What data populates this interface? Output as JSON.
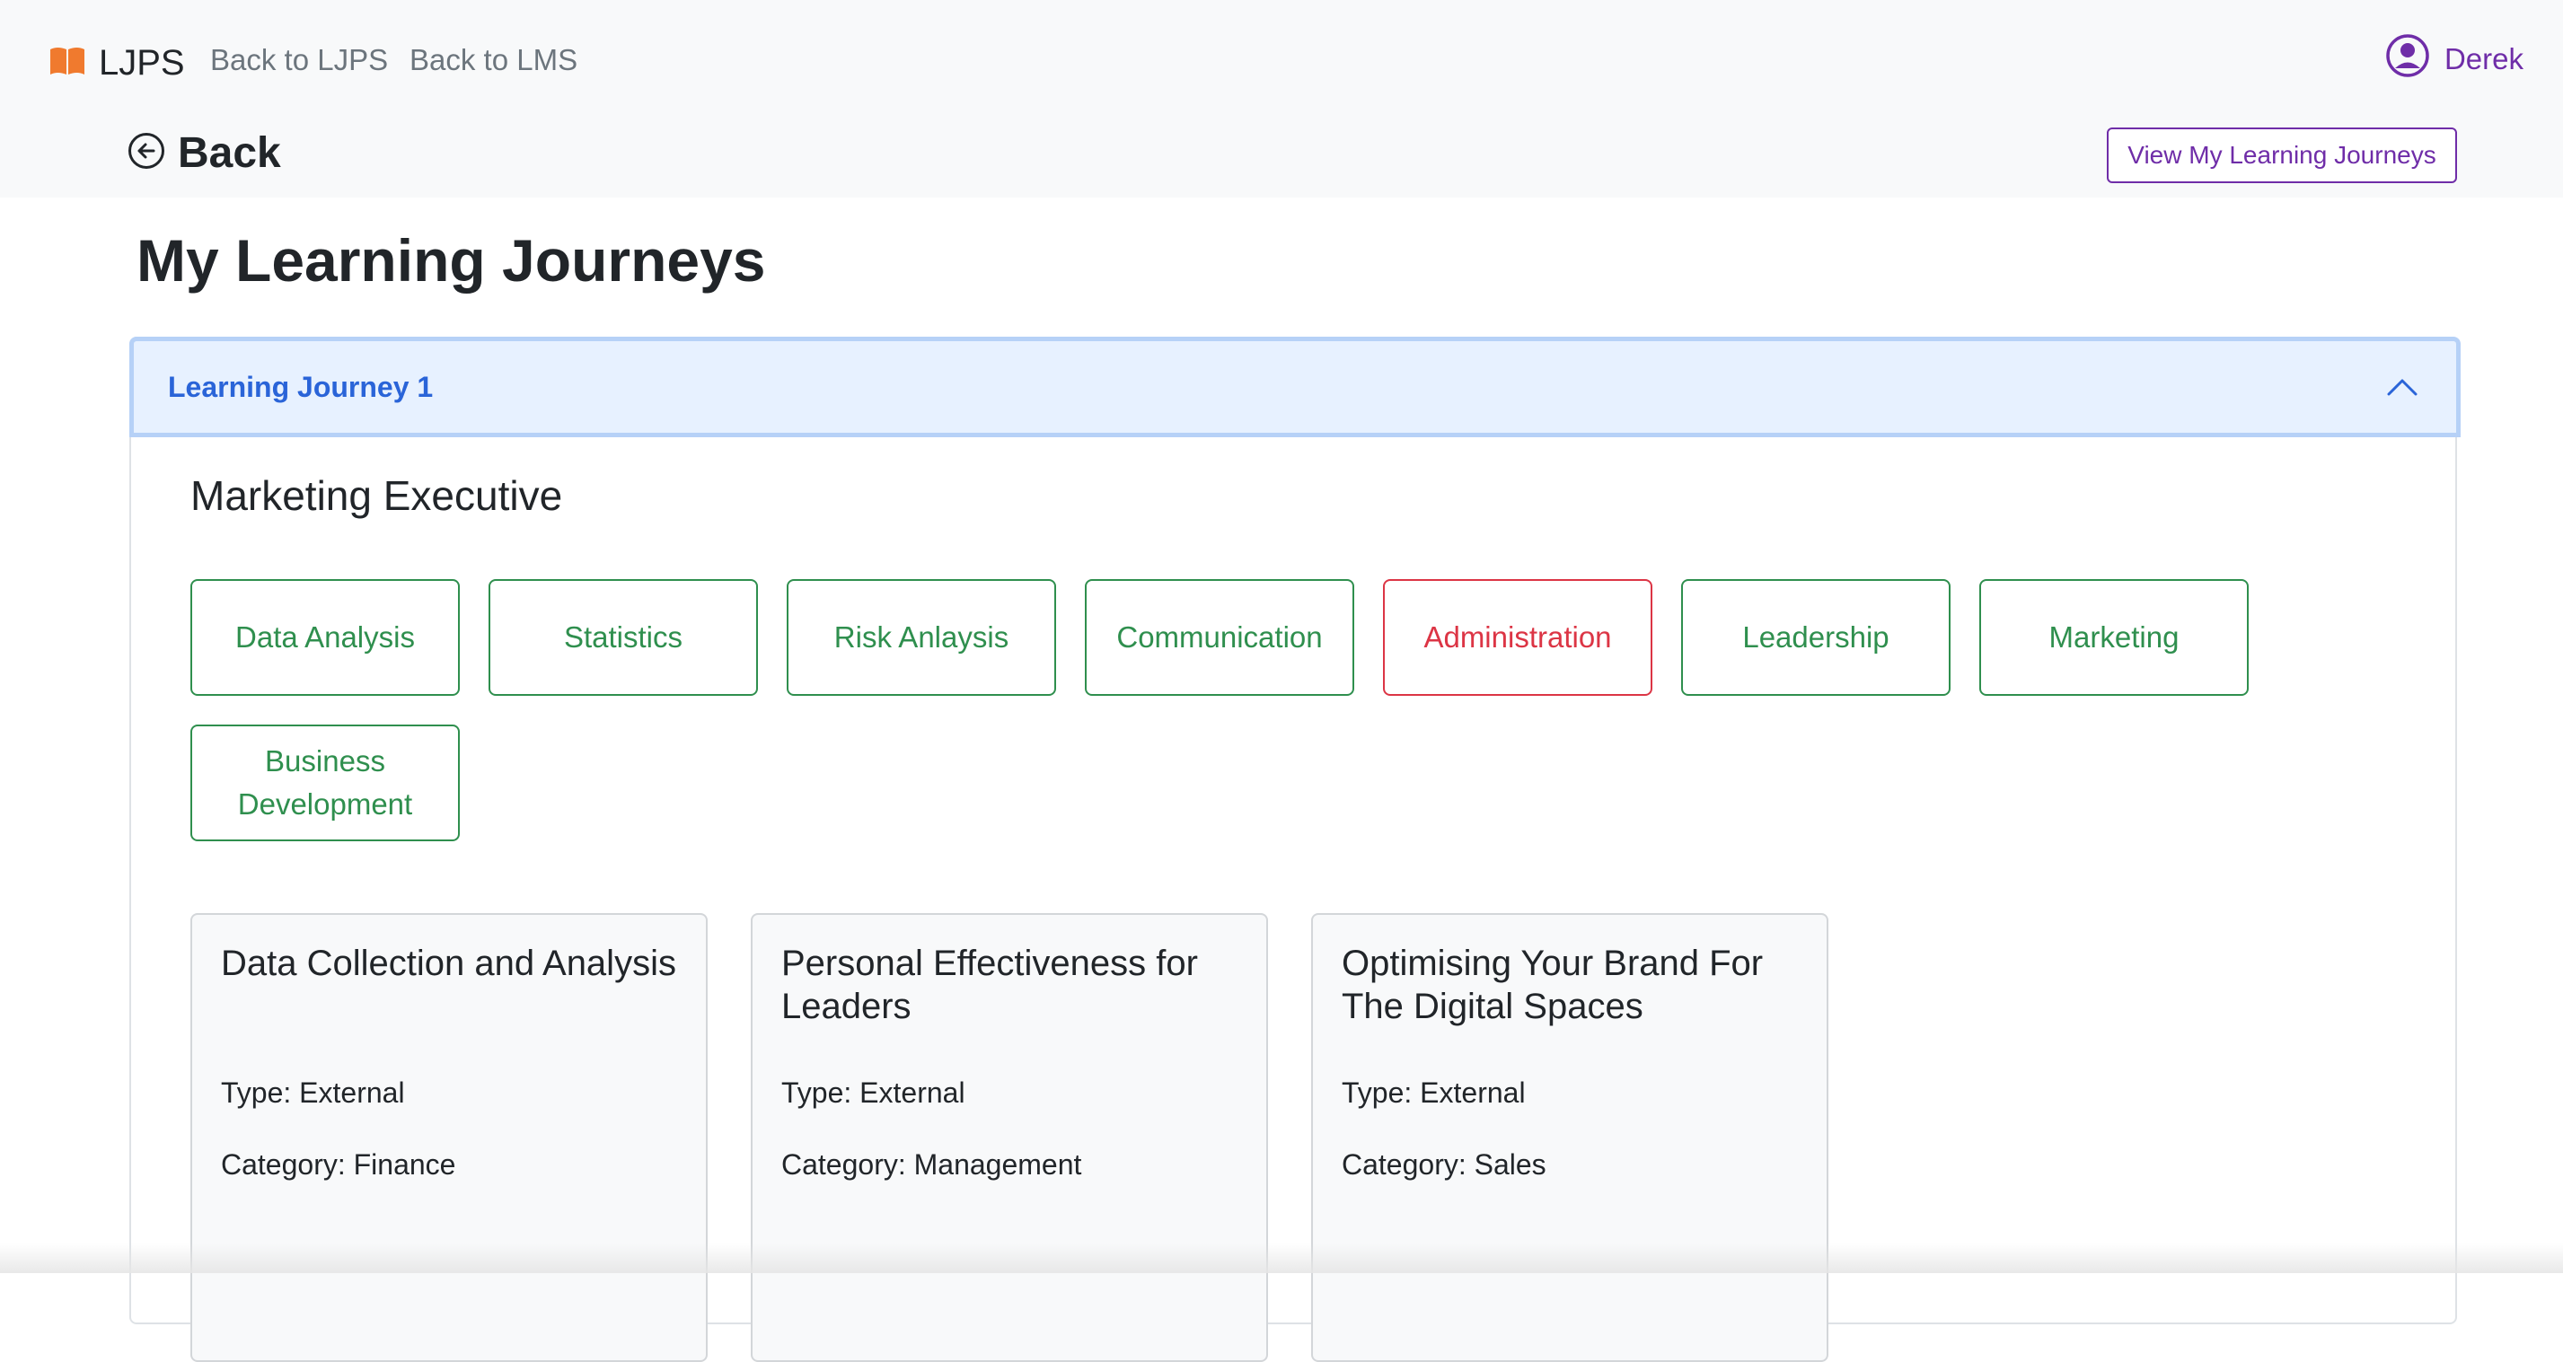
{
  "navbar": {
    "brand": "LJPS",
    "links": [
      "Back to LJPS",
      "Back to LMS"
    ],
    "user": "Derek"
  },
  "subheader": {
    "back_label": "Back",
    "view_button": "View My Learning Journeys"
  },
  "page": {
    "title": "My Learning Journeys"
  },
  "journey": {
    "header": "Learning Journey 1",
    "role": "Marketing Executive",
    "skills": [
      {
        "label": "Data Analysis",
        "status": "green"
      },
      {
        "label": "Statistics",
        "status": "green"
      },
      {
        "label": "Risk Anlaysis",
        "status": "green"
      },
      {
        "label": "Communication",
        "status": "green"
      },
      {
        "label": "Administration",
        "status": "red"
      },
      {
        "label": "Leadership",
        "status": "green"
      },
      {
        "label": "Marketing",
        "status": "green"
      },
      {
        "label": "Business Development",
        "status": "green"
      }
    ],
    "courses": [
      {
        "title": "Data Collection and Analysis",
        "type": "Type: External",
        "category": "Category: Finance"
      },
      {
        "title": "Personal Effectiveness for Leaders",
        "type": "Type: External",
        "category": "Category: Management"
      },
      {
        "title": "Optimising Your Brand For The Digital Spaces",
        "type": "Type: External",
        "category": "Category: Sales"
      }
    ]
  },
  "colors": {
    "accent_purple": "#6f2da8",
    "brand_orange": "#f07a2e",
    "skill_green": "#2f8f4e",
    "skill_red": "#dc3545",
    "accordion_blue": "#2a64d8"
  }
}
